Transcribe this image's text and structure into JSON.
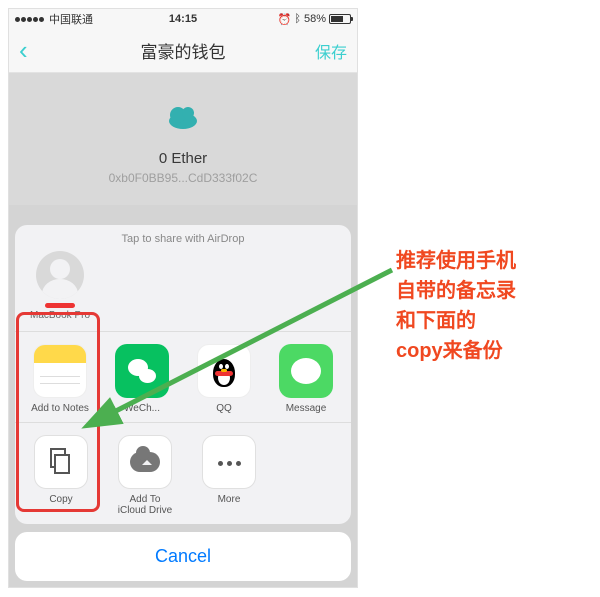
{
  "status_bar": {
    "carrier": "中国联通",
    "time": "14:15",
    "alarm_icon": "⏰",
    "bt_icon": "ᛒ",
    "battery_pct": "58%"
  },
  "nav": {
    "title": "富豪的钱包",
    "save": "保存"
  },
  "wallet": {
    "balance": "0 Ether",
    "address": "0xb0F0BB95...CdD333f02C"
  },
  "share_sheet": {
    "airdrop_hint": "Tap to share with AirDrop",
    "airdrop_target": "MacBook Pro",
    "apps": [
      {
        "label": "Add to Notes"
      },
      {
        "label": "WeCh..."
      },
      {
        "label": "QQ"
      },
      {
        "label": "Message"
      }
    ],
    "actions": [
      {
        "label": "Copy"
      },
      {
        "label": "Add To\niCloud Drive"
      },
      {
        "label": "More"
      }
    ],
    "cancel": "Cancel"
  },
  "annotation": {
    "l1": "推荐使用手机",
    "l2": "自带的备忘录",
    "l3": "和下面的",
    "l4": "copy来备份"
  }
}
